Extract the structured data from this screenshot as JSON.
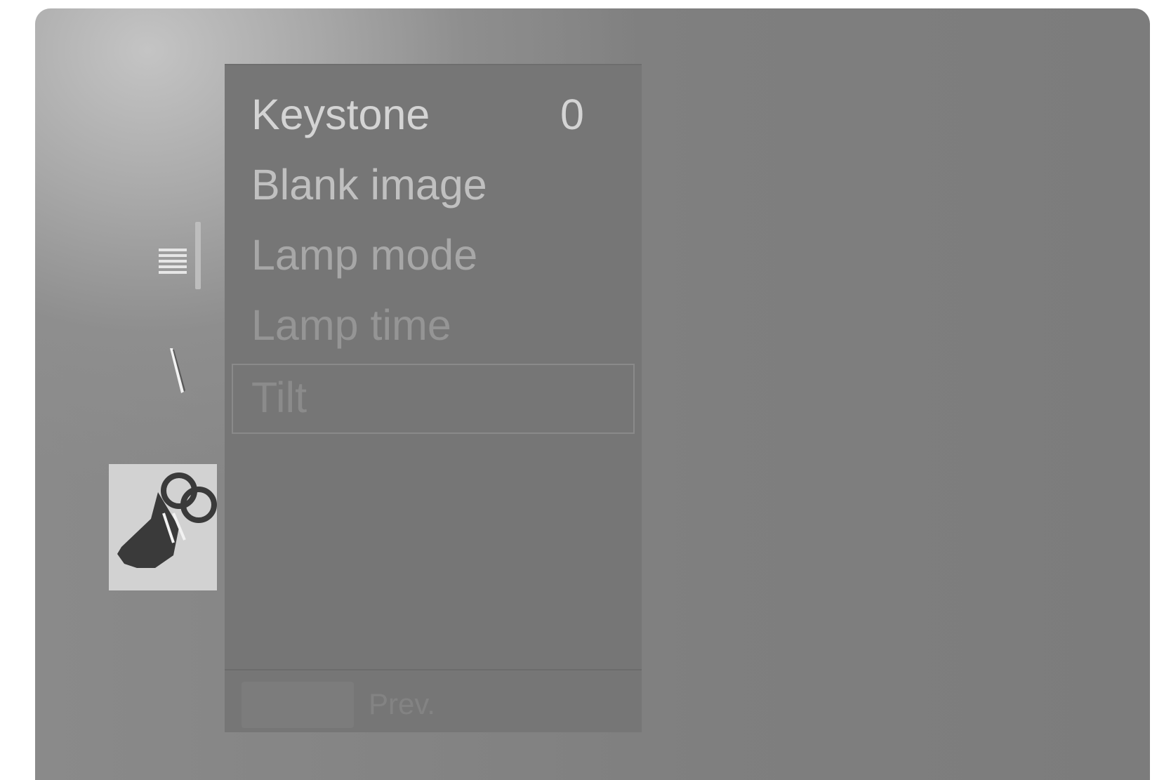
{
  "menu": {
    "items": [
      {
        "label": "Keystone",
        "value": "0"
      },
      {
        "label": "Blank image",
        "value": ""
      },
      {
        "label": "Lamp mode",
        "value": ""
      },
      {
        "label": "Lamp time",
        "value": ""
      },
      {
        "label": "Tilt",
        "value": ""
      }
    ],
    "selected_index": 4
  },
  "footer": {
    "prev_label": "Prev."
  },
  "tabs": [
    {
      "icon": "list-icon"
    },
    {
      "icon": "tool-icon"
    },
    {
      "icon": "projector-icon",
      "selected": true
    }
  ],
  "colors": {
    "screen_bg": "#808080",
    "panel_bg": "#767676",
    "selected_tab_bg": "#d2d2d2"
  }
}
